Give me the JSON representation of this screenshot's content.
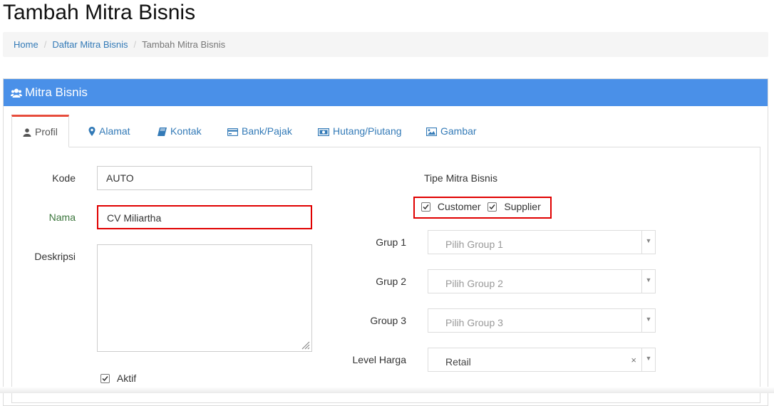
{
  "page": {
    "title": "Tambah Mitra Bisnis"
  },
  "breadcrumb": {
    "home": "Home",
    "list": "Daftar Mitra Bisnis",
    "current": "Tambah Mitra Bisnis",
    "separator": "/"
  },
  "panel": {
    "title": "Mitra Bisnis",
    "accent": "#4a90e8"
  },
  "tabs": [
    {
      "label": "Profil",
      "icon": "user-icon",
      "active": true
    },
    {
      "label": "Alamat",
      "icon": "map-marker-icon"
    },
    {
      "label": "Kontak",
      "icon": "book-icon"
    },
    {
      "label": "Bank/Pajak",
      "icon": "credit-card-icon"
    },
    {
      "label": "Hutang/Piutang",
      "icon": "money-icon"
    },
    {
      "label": "Gambar",
      "icon": "image-icon"
    }
  ],
  "form": {
    "kode": {
      "label": "Kode",
      "value": "AUTO"
    },
    "nama": {
      "label": "Nama",
      "value": "CV Miliartha"
    },
    "deskripsi": {
      "label": "Deskripsi",
      "value": ""
    },
    "aktif": {
      "label": "Aktif",
      "checked": true
    },
    "tipe": {
      "label": "Tipe Mitra Bisnis",
      "customer": {
        "label": "Customer",
        "checked": true
      },
      "supplier": {
        "label": "Supplier",
        "checked": true
      }
    },
    "grup1": {
      "label": "Grup 1",
      "placeholder": "Pilih Group 1"
    },
    "grup2": {
      "label": "Grup 2",
      "placeholder": "Pilih Group 2"
    },
    "group3": {
      "label": "Group 3",
      "placeholder": "Pilih Group 3"
    },
    "level_harga": {
      "label": "Level Harga",
      "value": "Retail",
      "clear": "×"
    }
  }
}
